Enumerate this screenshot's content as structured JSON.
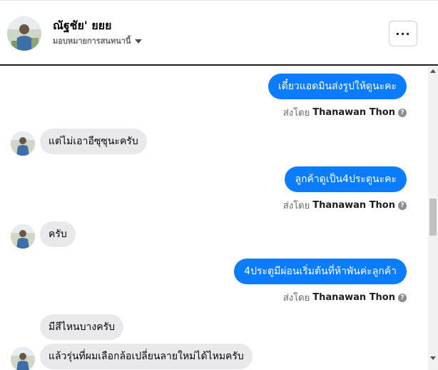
{
  "header": {
    "name": "ณัฐชัย' ยยย",
    "subtitle": "มอบหมายการสนทนานี้",
    "more_label": "···"
  },
  "messages": [
    {
      "direction": "out",
      "text": "เดี๋ยวแอดมินส่งรูปให้ดูนะคะ",
      "sent_by_prefix": "ส่งโดย",
      "sent_by": "Thanawan Thon"
    },
    {
      "direction": "in",
      "text": "แต่ไม่เอาอีซุซุนะครับ"
    },
    {
      "direction": "out",
      "text": "ลูกค้าดูเป็น4ประตูนะคะ",
      "sent_by_prefix": "ส่งโดย",
      "sent_by": "Thanawan Thon"
    },
    {
      "direction": "in",
      "text": "ครับ"
    },
    {
      "direction": "out",
      "text": "4ประตูมีผ่อนเริ่มต้นที่ห้าพันค่ะลูกค้า",
      "sent_by_prefix": "ส่งโดย",
      "sent_by": "Thanawan Thon"
    },
    {
      "direction": "in",
      "text": "มีสีไหนบางครับ"
    },
    {
      "direction": "in",
      "text": "แล้วรุ่นที่ผมเลือกล้อเปลี่ยนลายใหม่ได้ไหมครับ"
    }
  ],
  "colors": {
    "outgoing_bubble": "#0a7cff",
    "incoming_bubble": "#e9e9eb"
  },
  "icons": {
    "more": "more-horizontal-icon",
    "help": "question-circle-icon",
    "dropdown": "caret-down-icon"
  }
}
